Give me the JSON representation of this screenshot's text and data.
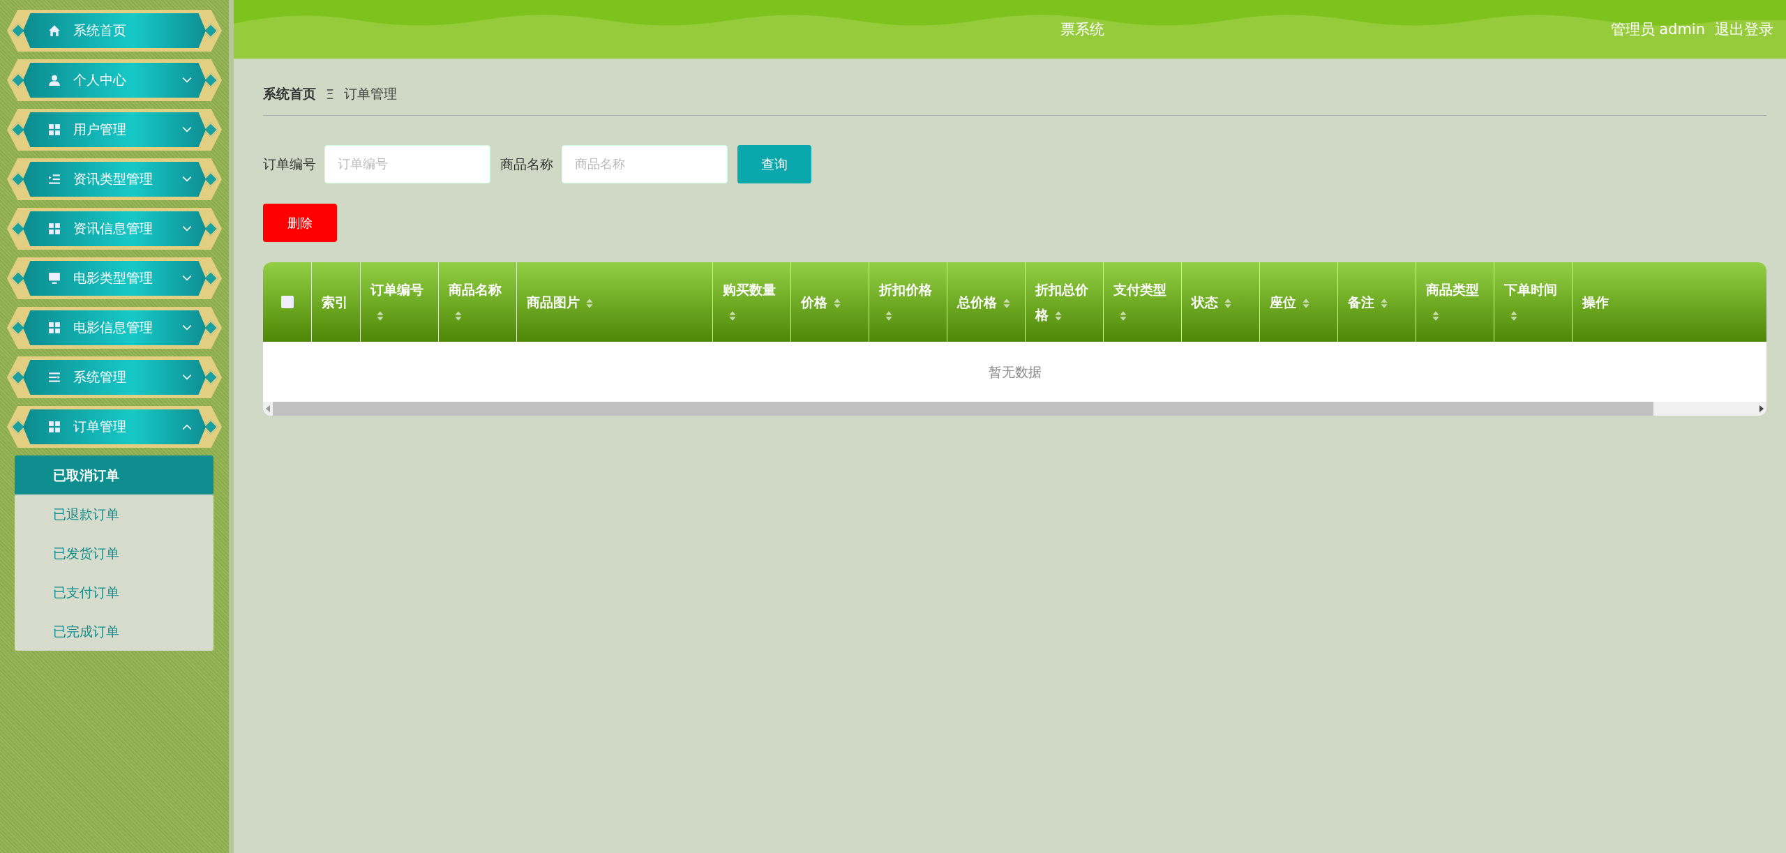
{
  "sidebar": {
    "items": [
      {
        "label": "系统首页"
      },
      {
        "label": "个人中心",
        "expanded": false
      },
      {
        "label": "用户管理",
        "expanded": false
      },
      {
        "label": "资讯类型管理",
        "expanded": false
      },
      {
        "label": "资讯信息管理",
        "expanded": false
      },
      {
        "label": "电影类型管理",
        "expanded": false
      },
      {
        "label": "电影信息管理",
        "expanded": false
      },
      {
        "label": "系统管理",
        "expanded": false
      },
      {
        "label": "订单管理",
        "expanded": true,
        "children": [
          {
            "label": "已取消订单",
            "selected": true
          },
          {
            "label": "已退款订单",
            "selected": false
          },
          {
            "label": "已发货订单",
            "selected": false
          },
          {
            "label": "已支付订单",
            "selected": false
          },
          {
            "label": "已完成订单",
            "selected": false
          }
        ]
      }
    ]
  },
  "header": {
    "title": "票系统",
    "user": "管理员 admin",
    "logout": "退出登录"
  },
  "breadcrumb": [
    "系统首页",
    "订单管理"
  ],
  "breadcrumb_separator": "Ξ",
  "search": {
    "fields": [
      {
        "label": "订单编号",
        "placeholder": "订单编号"
      },
      {
        "label": "商品名称",
        "placeholder": "商品名称"
      }
    ],
    "button": "查询"
  },
  "delete_button": "删除",
  "table": {
    "select_all": {
      "checked": false
    },
    "columns": [
      {
        "label": "索引",
        "sortable": false
      },
      {
        "label": "订单编号",
        "sortable": true
      },
      {
        "label": "商品名称",
        "sortable": true
      },
      {
        "label": "商品图片",
        "sortable": true
      },
      {
        "label": "购买数量",
        "sortable": true
      },
      {
        "label": "价格",
        "sortable": true
      },
      {
        "label": "折扣价格",
        "sortable": true
      },
      {
        "label": "总价格",
        "sortable": true
      },
      {
        "label": "折扣总价格",
        "sortable": true
      },
      {
        "label": "支付类型",
        "sortable": true
      },
      {
        "label": "状态",
        "sortable": true
      },
      {
        "label": "座位",
        "sortable": true
      },
      {
        "label": "备注",
        "sortable": true
      },
      {
        "label": "商品类型",
        "sortable": true
      },
      {
        "label": "下单时间",
        "sortable": true
      },
      {
        "label": "操作",
        "sortable": false
      }
    ],
    "empty_text": "暂无数据"
  }
}
